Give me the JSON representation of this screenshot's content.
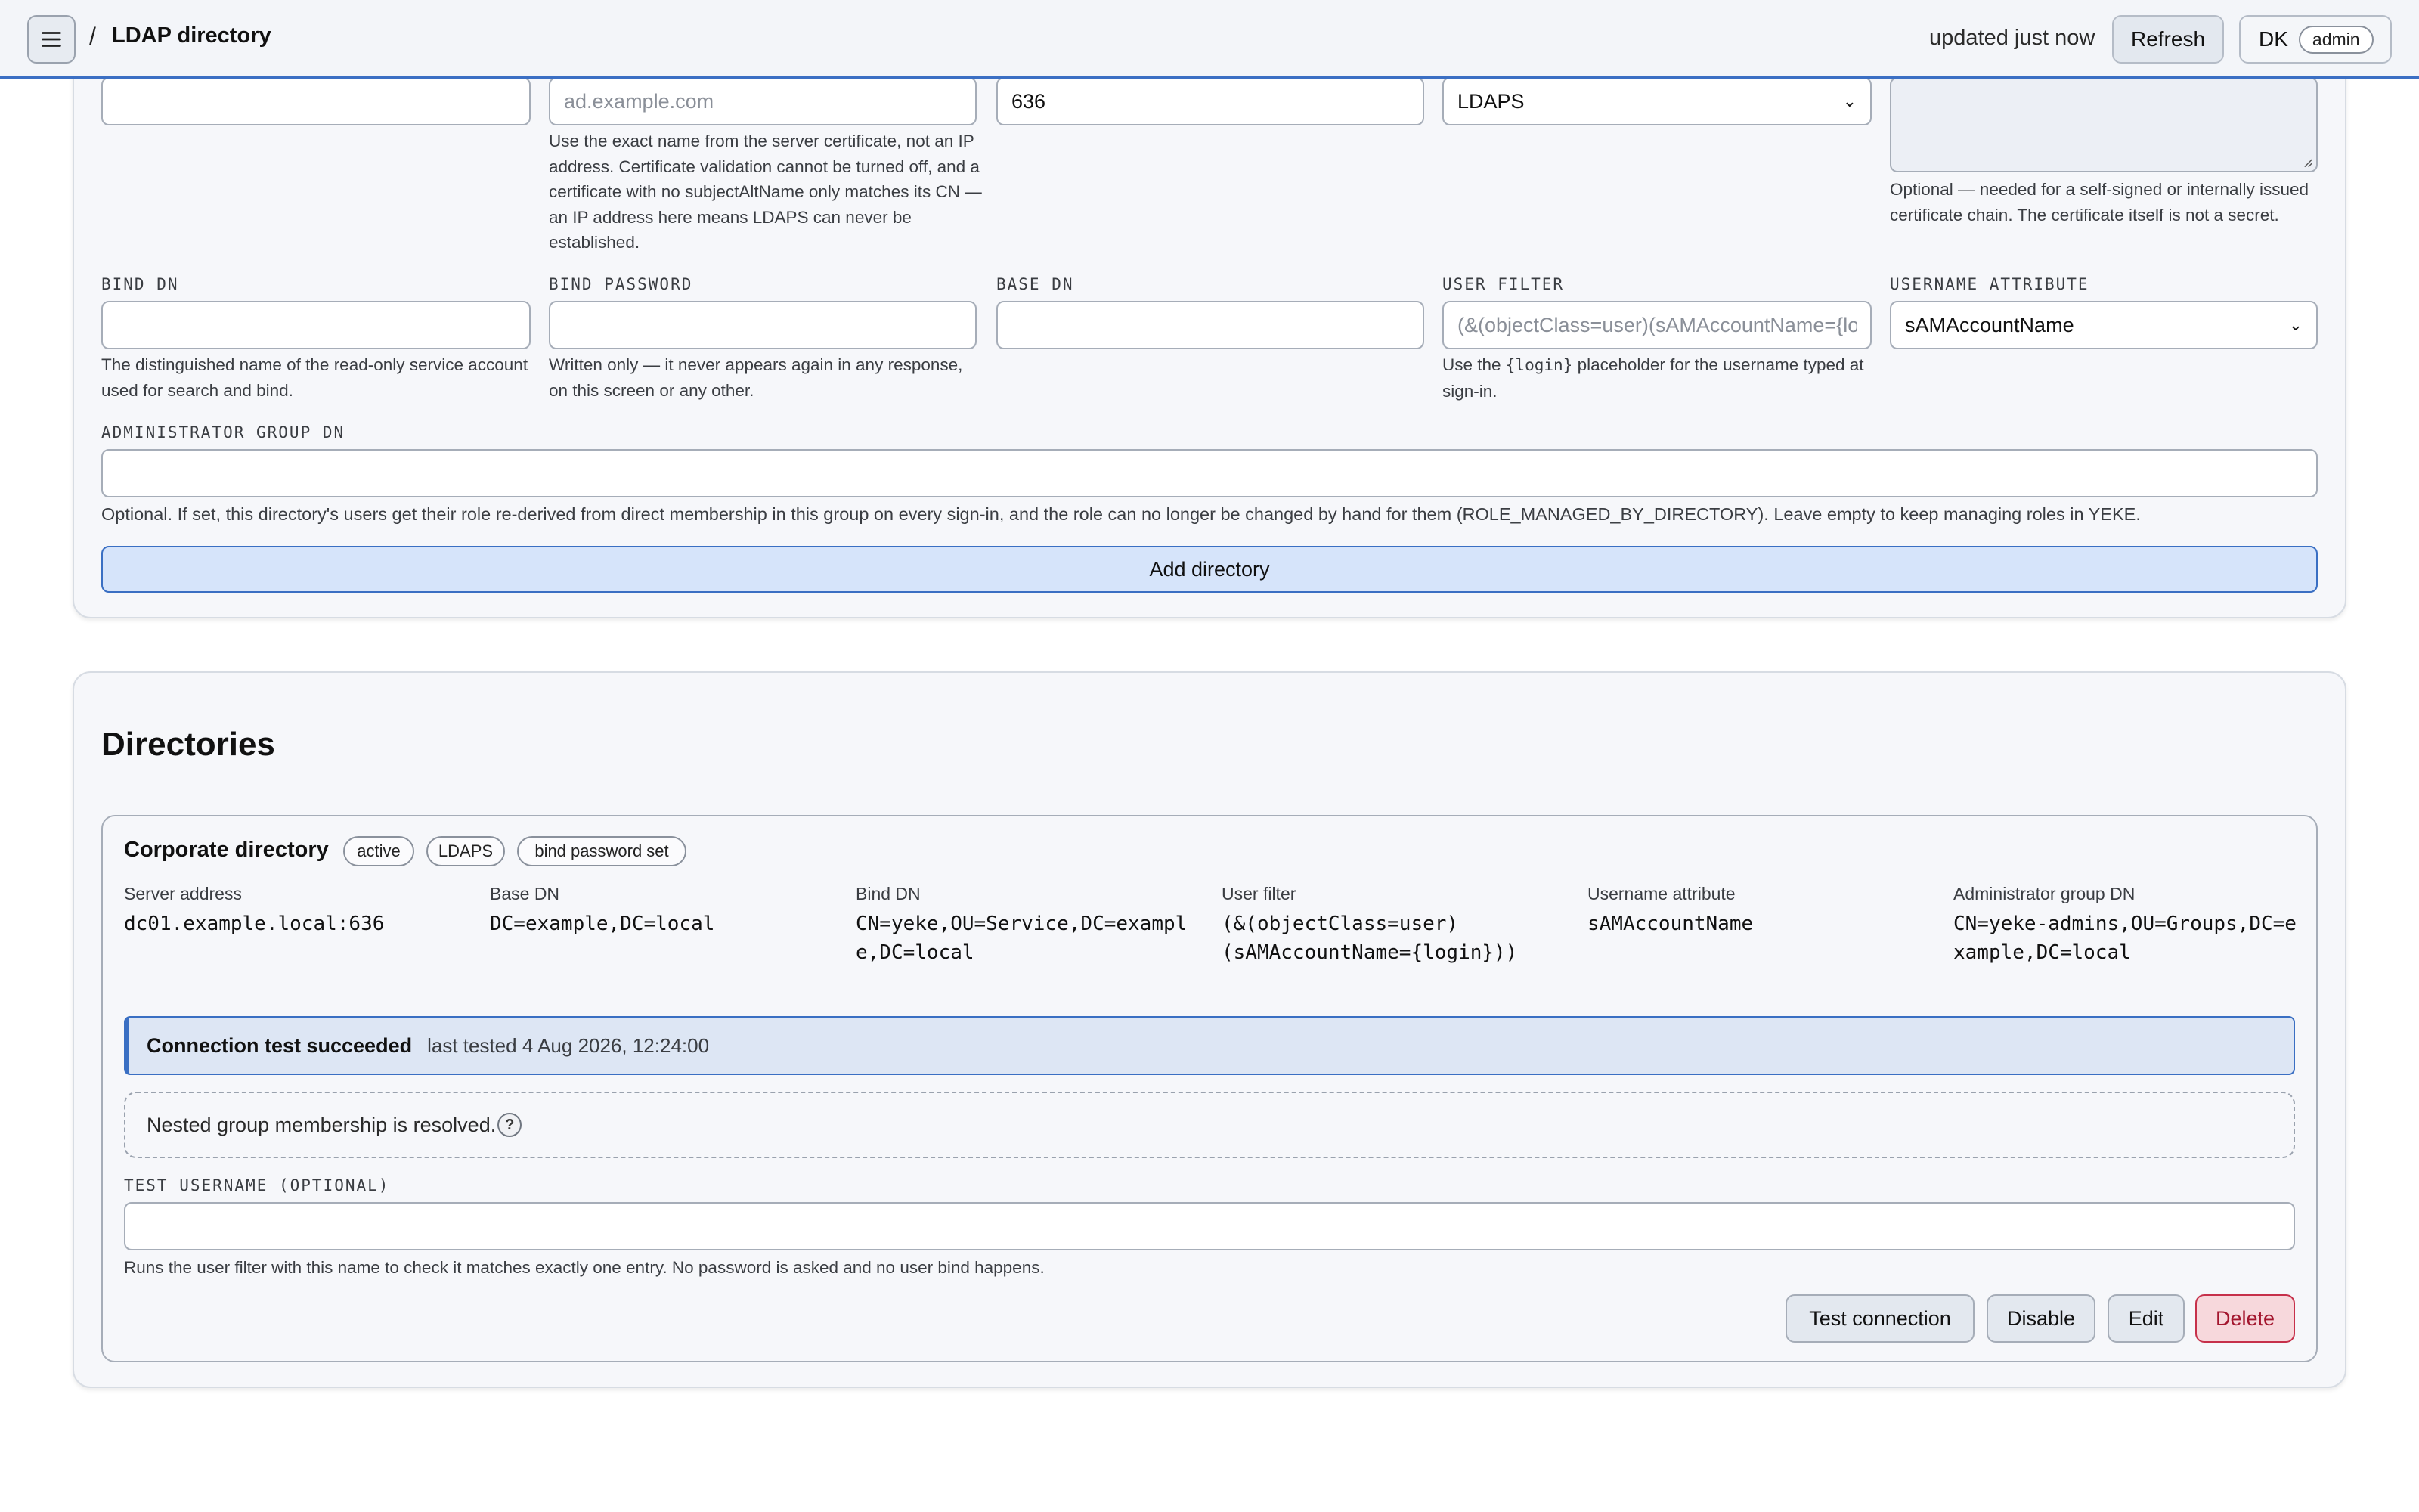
{
  "header": {
    "separator": "/",
    "title": "LDAP directory",
    "updated": "updated just now",
    "refresh_label": "Refresh",
    "user_initials": "DK",
    "user_role": "admin"
  },
  "form": {
    "host": {
      "value": "",
      "placeholder": "ad.example.com",
      "help": "Use the exact name from the server certificate, not an IP address. Certificate validation cannot be turned off, and a certificate with no subjectAltName only matches its CN — an IP address here means LDAPS can never be established."
    },
    "name": {
      "value": ""
    },
    "port": {
      "value": "636"
    },
    "protocol": {
      "value": "LDAPS"
    },
    "ca_cert": {
      "help": "Optional — needed for a self-signed or internally issued certificate chain. The certificate itself is not a secret."
    },
    "bind_dn": {
      "label": "BIND DN",
      "value": "",
      "help": "The distinguished name of the read-only service account used for search and bind."
    },
    "bind_password": {
      "label": "BIND PASSWORD",
      "value": "",
      "help": "Written only — it never appears again in any response, on this screen or any other."
    },
    "base_dn": {
      "label": "BASE DN",
      "value": ""
    },
    "user_filter": {
      "label": "USER FILTER",
      "placeholder": "(&(objectClass=user)(sAMAccountName={login}))",
      "help_pre": "Use the ",
      "help_code": "{login}",
      "help_post": " placeholder for the username typed at sign-in."
    },
    "username_attribute": {
      "label": "USERNAME ATTRIBUTE",
      "value": "sAMAccountName"
    },
    "admin_group_dn": {
      "label": "ADMINISTRATOR GROUP DN",
      "value": "",
      "help": "Optional. If set, this directory's users get their role re-derived from direct membership in this group on every sign-in, and the role can no longer be changed by hand for them (ROLE_MANAGED_BY_DIRECTORY). Leave empty to keep managing roles in YEKE."
    },
    "submit_label": "Add directory"
  },
  "directories": {
    "title": "Directories",
    "items": [
      {
        "name": "Corporate directory",
        "badges": [
          "active",
          "LDAPS",
          "bind password set"
        ],
        "fields": [
          {
            "label": "Server address",
            "value": "dc01.example.local:636"
          },
          {
            "label": "Base DN",
            "value": "DC=example,DC=local"
          },
          {
            "label": "Bind DN",
            "value": "CN=yeke,OU=Service,DC=example,DC=local"
          },
          {
            "label": "User filter",
            "value": "(&(objectClass=user)(sAMAccountName={login}))"
          },
          {
            "label": "Username attribute",
            "value": "sAMAccountName"
          },
          {
            "label": "Administrator group DN",
            "value": "CN=yeke-admins,OU=Groups,DC=example,DC=local"
          }
        ],
        "test_status": "Connection test succeeded",
        "test_time": "last tested 4 Aug 2026, 12:24:00",
        "nested_note": "Nested group membership is resolved.",
        "nested_help": "?",
        "test_username": {
          "label": "TEST USERNAME (OPTIONAL)",
          "value": "",
          "help": "Runs the user filter with this name to check it matches exactly one entry. No password is asked and no user bind happens."
        },
        "actions": {
          "test": "Test connection",
          "disable": "Disable",
          "edit": "Edit",
          "delete": "Delete"
        }
      }
    ]
  },
  "colors": {
    "accent": "#3a6fc3",
    "danger": "#c6304a",
    "info_bg": "#dde6f4"
  },
  "icons": {
    "menu": "hamburger-icon",
    "help": "question-icon",
    "dropdown": "chevron-down-icon"
  }
}
